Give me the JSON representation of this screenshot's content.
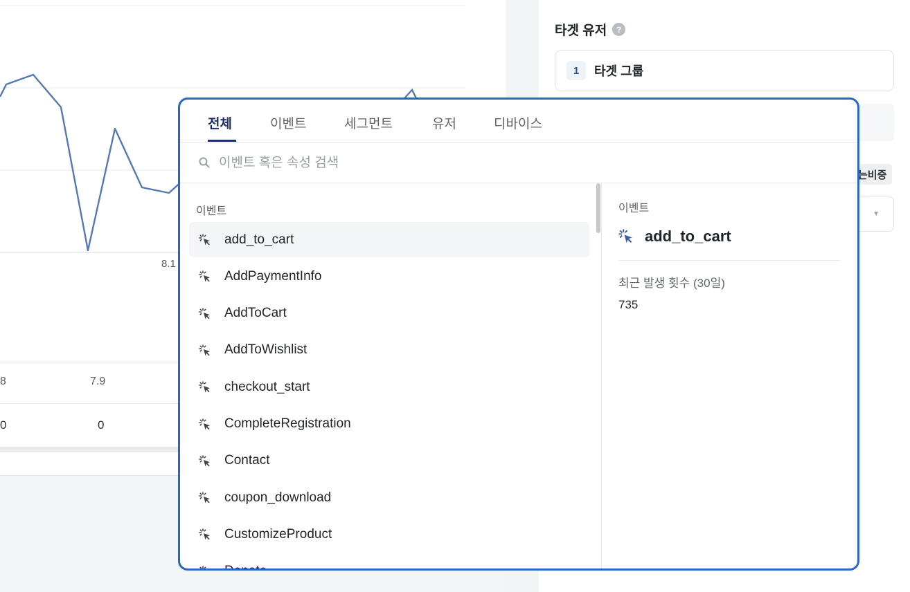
{
  "background": {
    "chart": {
      "x_tick_partial": "8.1",
      "table_header": [
        "8",
        "7.9"
      ],
      "table_values": [
        "0",
        "0"
      ]
    },
    "right_panel": {
      "section_title": "타겟 유저",
      "help_icon": "question-circle-icon",
      "group_number": "1",
      "group_label": "타겟 그룹",
      "partial_label": "는비중"
    }
  },
  "popover": {
    "tabs": [
      {
        "label": "전체",
        "active": true
      },
      {
        "label": "이벤트",
        "active": false
      },
      {
        "label": "세그먼트",
        "active": false
      },
      {
        "label": "유저",
        "active": false
      },
      {
        "label": "디바이스",
        "active": false
      }
    ],
    "search": {
      "placeholder": "이벤트 혹은 속성 검색",
      "value": ""
    },
    "list": {
      "header": "이벤트",
      "items": [
        "add_to_cart",
        "AddPaymentInfo",
        "AddToCart",
        "AddToWishlist",
        "checkout_start",
        "CompleteRegistration",
        "Contact",
        "coupon_download",
        "CustomizeProduct",
        "Donate"
      ],
      "hovered_index": 0
    },
    "detail": {
      "kicker": "이벤트",
      "title": "add_to_cart",
      "metric_label": "최근 발생 횟수 (30일)",
      "metric_value": "735"
    }
  },
  "colors": {
    "accent_border": "#2a66c8",
    "active_tab": "#1c2f6b",
    "chart_line": "#5478b4"
  }
}
